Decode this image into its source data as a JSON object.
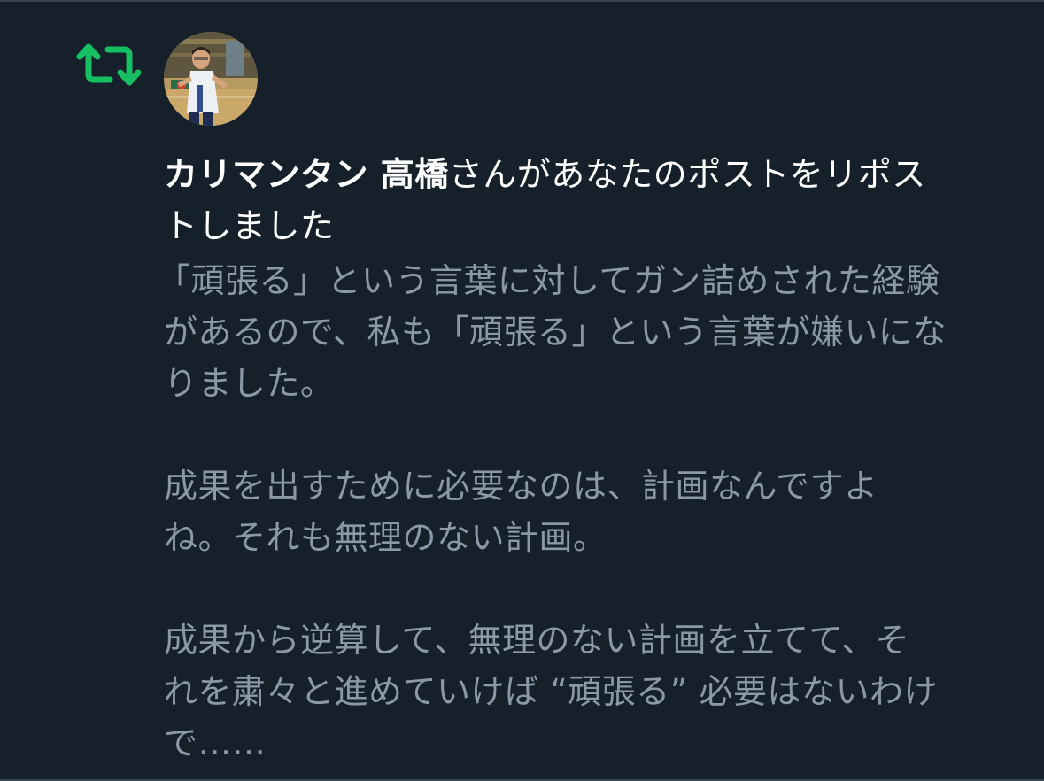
{
  "notification": {
    "type_icon": "repost-icon",
    "avatar_icon": "user-avatar-photo",
    "user_name": "カリマンタン 高橋",
    "action_text_line1": "さんがあなたのポストをリポス",
    "action_text_line2": "トしました",
    "post_lines": [
      "「頑張る」という言葉に対してガン詰めされた経験",
      "があるので、私も「頑張る」という言葉が嫌いにな",
      "りました。",
      "",
      "成果を出すために必要なのは、計画なんですよ",
      "ね。それも無理のない計画。",
      "",
      "成果から逆算して、無理のない計画を立てて、そ",
      "れを粛々と進めていけば “頑張る” 必要はないわけ",
      "で……"
    ]
  },
  "colors": {
    "background": "#15202b",
    "repost_green": "#17bf63",
    "headline_text": "#ffffff",
    "post_text": "#8b98a5"
  }
}
